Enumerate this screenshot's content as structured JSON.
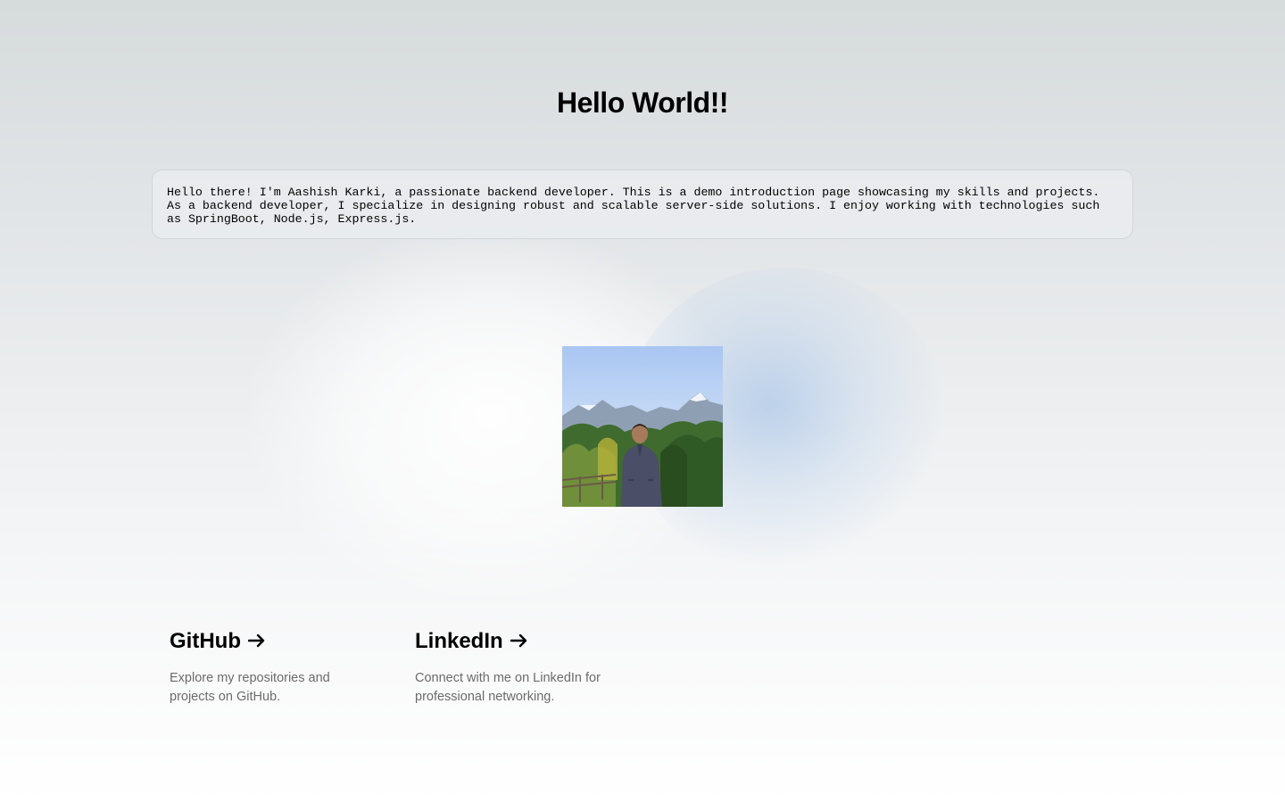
{
  "header": {
    "title": "Hello World!!"
  },
  "intro": {
    "text": "Hello there! I'm Aashish Karki, a passionate backend developer. This is a demo introduction page showcasing my skills and projects. As a backend developer, I specialize in designing robust and scalable server-side solutions. I enjoy working with technologies such as SpringBoot, Node.js, Express.js."
  },
  "cards": [
    {
      "title": "GitHub",
      "arrow": "->",
      "description": "Explore my repositories and projects on GitHub."
    },
    {
      "title": "LinkedIn",
      "arrow": "->",
      "description": "Connect with me on LinkedIn for professional networking."
    }
  ],
  "colors": {
    "background_top": "#d6dbdc",
    "background_bottom": "#ffffff",
    "description_text": "#6b6b6b",
    "intro_box_border": "#d2d6d9"
  }
}
